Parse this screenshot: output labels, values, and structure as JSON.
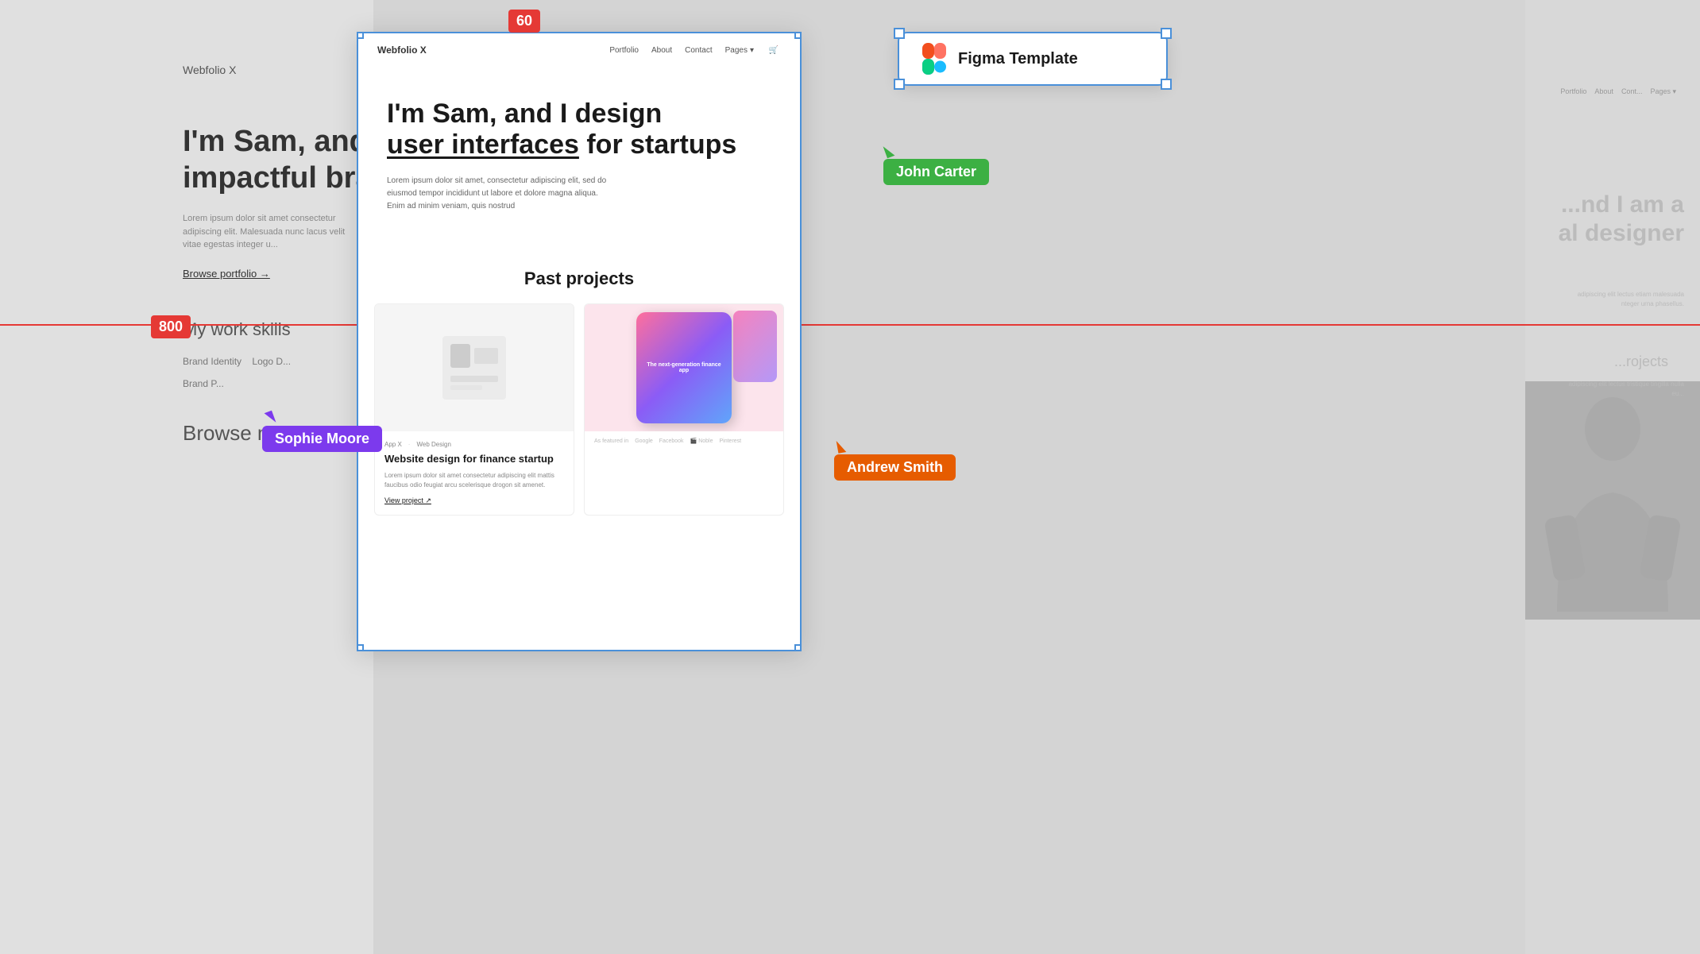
{
  "ruler": {
    "label_60": "60",
    "label_800": "800"
  },
  "left_panel": {
    "brand": "Webfolio X",
    "heading": "I'm Sam, and",
    "heading2": "impactful bra",
    "desc": "Lorem ipsum dolor sit amet consectetur adipiscing elit. Malesuada nunc lacus velit vitae egestas integer u...",
    "browse": "Browse portfolio →",
    "skills_title": "My work skills",
    "skill1": "Brand Identity",
    "skill2": "Logo D...",
    "skill3": "Brand P...",
    "browse_m": "Browse m..."
  },
  "right_panel": {
    "nav": [
      "Portfolio",
      "About",
      "Cont...",
      "Pages ▾"
    ],
    "heading1": "...nd I am a",
    "heading2": "al designer",
    "desc": "adipiscing elit lectus etiam malesuada nteger urna phasellus.",
    "projects": "...rojects",
    "project_desc": "adipiscing elit lectus tristique tingilla nulla eu..."
  },
  "figma_badge": {
    "text": "Figma Template",
    "icon": "figma-icon"
  },
  "cursors": {
    "john": {
      "name": "John Carter",
      "color": "#3cb043"
    },
    "sophie": {
      "name": "Sophie Moore",
      "color": "#7c3aed"
    },
    "andrew": {
      "name": "Andrew Smith",
      "color": "#e65c00"
    }
  },
  "main_frame": {
    "nav": {
      "brand": "Webfolio X",
      "links": [
        "Portfolio",
        "About",
        "Contact",
        "Pages ▾"
      ]
    },
    "hero": {
      "line1": "I'm Sam, and I design",
      "line2_plain": "user interfaces",
      "line2_rest": " for startups",
      "desc1": "Lorem ipsum dolor sit amet, consectetur adipiscing elit, sed do",
      "desc2": "eiusmod tempor incididunt ut labore et dolore magna aliqua.",
      "desc3": "Enim ad minim veniam, quis nostrud"
    },
    "projects": {
      "title": "Past projects",
      "card1": {
        "tag1": "App X",
        "separator": "·",
        "tag2": "Web Design",
        "title": "Website design for finance startup",
        "desc": "Lorem ipsum dolor sit amet consectetur adipiscing elit mattis faucibus odio feugiat arcu scelerisque drogon sit amenet.",
        "link": "View project ↗"
      },
      "card2": {
        "title": "The next-generation finance app",
        "featured_label": "As featured in",
        "logos": [
          "Google",
          "Facebook",
          "🎬 Noble",
          "Pinterest"
        ]
      }
    }
  }
}
